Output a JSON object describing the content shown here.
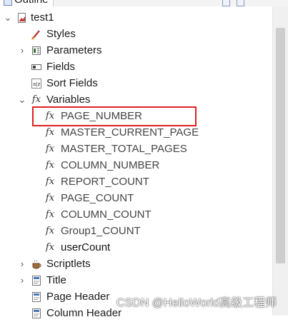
{
  "tab": {
    "title": "Outline"
  },
  "tree": {
    "root": "test1",
    "styles": "Styles",
    "parameters": "Parameters",
    "fields": "Fields",
    "sort_fields": "Sort Fields",
    "variables": {
      "label": "Variables",
      "items": [
        "PAGE_NUMBER",
        "MASTER_CURRENT_PAGE",
        "MASTER_TOTAL_PAGES",
        "COLUMN_NUMBER",
        "REPORT_COUNT",
        "PAGE_COUNT",
        "COLUMN_COUNT",
        "Group1_COUNT",
        "userCount"
      ]
    },
    "scriptlets": "Scriptlets",
    "title": "Title",
    "page_header": "Page Header",
    "column_header": "Column Header"
  },
  "icons": {
    "expand": "chevron-right-icon",
    "collapse": "chevron-down-icon",
    "variable": "fx-icon"
  },
  "colors": {
    "highlight": "#e02020"
  },
  "watermark": "CSDN @HelloWorld高级工程师"
}
